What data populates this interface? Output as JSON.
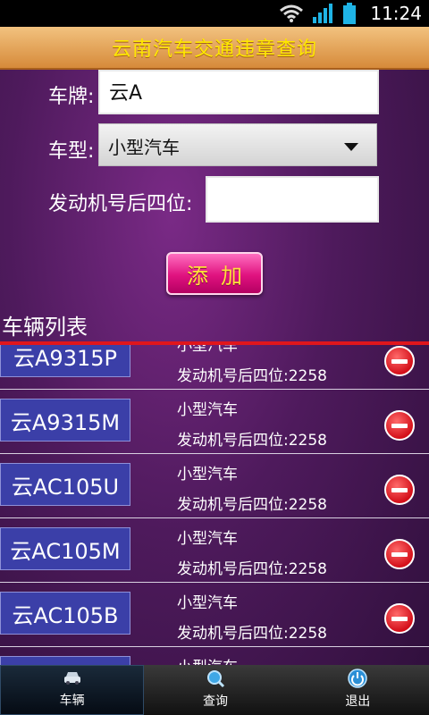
{
  "status": {
    "time": "11:24"
  },
  "title": "云南汽车交通违章查询",
  "form": {
    "plate_label": "车牌:",
    "plate_value": "云A",
    "type_label": "车型:",
    "type_value": "小型汽车",
    "engine_label": "发动机号后四位:",
    "engine_value": "",
    "add_button": "添加"
  },
  "list_title": "车辆列表",
  "vehicles": [
    {
      "plate": "云A9315P",
      "type": "小型汽车",
      "engine": "发动机号后四位:2258"
    },
    {
      "plate": "云A9315M",
      "type": "小型汽车",
      "engine": "发动机号后四位:2258"
    },
    {
      "plate": "云AC105U",
      "type": "小型汽车",
      "engine": "发动机号后四位:2258"
    },
    {
      "plate": "云AC105M",
      "type": "小型汽车",
      "engine": "发动机号后四位:2258"
    },
    {
      "plate": "云AC105B",
      "type": "小型汽车",
      "engine": "发动机号后四位:2258"
    },
    {
      "plate": "",
      "type": "小型汽车",
      "engine": ""
    }
  ],
  "tabs": [
    {
      "label": "车辆",
      "icon": "car-icon"
    },
    {
      "label": "查询",
      "icon": "search-icon"
    },
    {
      "label": "退出",
      "icon": "power-icon"
    }
  ]
}
